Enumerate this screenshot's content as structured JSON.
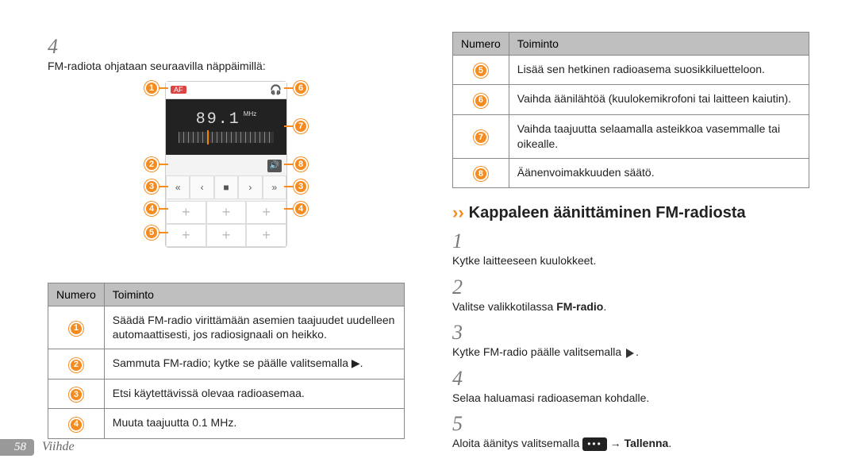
{
  "footer": {
    "page": "58",
    "category": "Viihde"
  },
  "left": {
    "step4_num": "4",
    "step4_text": "FM-radiota ohjataan seuraavilla näppäimillä:",
    "radio": {
      "af": "AF",
      "freq": "89.1",
      "mhz": "MHz"
    },
    "table_head": {
      "num": "Numero",
      "func": "Toiminto"
    },
    "rows": [
      {
        "n": "1",
        "t": "Säädä FM-radio virittämään asemien taajuudet uudelleen automaattisesti, jos radiosignaali on heikko."
      },
      {
        "n": "2",
        "t": "Sammuta FM-radio; kytke se päälle valitsemalla ▶."
      },
      {
        "n": "3",
        "t": "Etsi käytettävissä olevaa radioasemaa."
      },
      {
        "n": "4",
        "t": "Muuta taajuutta 0.1 MHz."
      }
    ]
  },
  "right": {
    "table_head": {
      "num": "Numero",
      "func": "Toiminto"
    },
    "rows": [
      {
        "n": "5",
        "t": "Lisää sen hetkinen radioasema suosikkiluetteloon."
      },
      {
        "n": "6",
        "t": "Vaihda äänilähtöä (kuulokemikrofoni tai laitteen kaiutin)."
      },
      {
        "n": "7",
        "t": "Vaihda taajuutta selaamalla asteikkoa vasemmalle tai oikealle."
      },
      {
        "n": "8",
        "t": "Äänenvoimakkuuden säätö."
      }
    ],
    "section_title": "Kappaleen äänittäminen FM-radiosta",
    "steps": {
      "s1n": "1",
      "s1t": "Kytke laitteeseen kuulokkeet.",
      "s2n": "2",
      "s2t_a": "Valitse valikkotilassa ",
      "s2t_b": "FM-radio",
      "s2t_c": ".",
      "s3n": "3",
      "s3t": "Kytke FM-radio päälle valitsemalla ",
      "s4n": "4",
      "s4t": "Selaa haluamasi radioaseman kohdalle.",
      "s5n": "5",
      "s5t_a": "Aloita äänitys valitsemalla ",
      "s5t_menu": "•••",
      "s5t_arrow": " → ",
      "s5t_b": "Tallenna",
      "s5t_c": "."
    }
  }
}
